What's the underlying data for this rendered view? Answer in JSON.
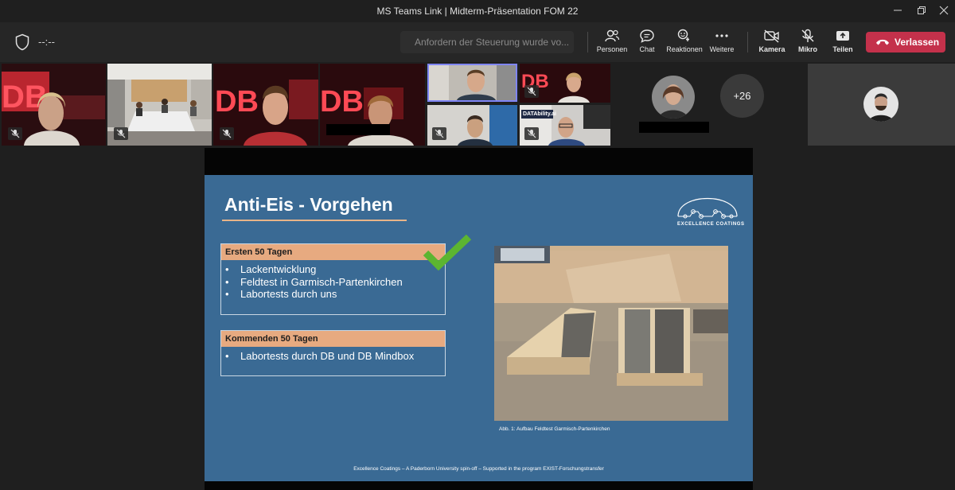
{
  "window": {
    "title": "MS Teams Link | Midterm-Präsentation FOM 22"
  },
  "toolbar": {
    "timer": "--:--",
    "request_control": "Anfordern der Steuerung wurde vo...",
    "buttons": {
      "people": "Personen",
      "chat": "Chat",
      "reactions": "Reaktionen",
      "more": "Weitere",
      "camera": "Kamera",
      "mic": "Mikro",
      "share": "Teilen"
    },
    "leave_label": "Verlassen"
  },
  "participants": {
    "overflow_count": "+26",
    "tile_banner_text": "DATAbility.ai"
  },
  "slide": {
    "title": "Anti-Eis - Vorgehen",
    "logo_text": "EXCELLENCE COATINGS",
    "section1": {
      "header": "Ersten 50 Tagen",
      "items": [
        "Lackentwicklung",
        "Feldtest in Garmisch-Partenkirchen",
        "Labortests durch uns"
      ]
    },
    "section2": {
      "header": "Kommenden 50 Tagen",
      "items": [
        "Labortests durch DB und DB Mindbox"
      ]
    },
    "photo_caption": "Abb. 1: Aufbau Feldtest Garmisch-Partenkirchen",
    "footer": "Excellence Coatings – A Paderborn University spin-off – Supported in the program EXIST-Forschungstransfer"
  },
  "colors": {
    "leave_button": "#c4314b",
    "slide_background": "#3a6a94",
    "section_header": "#e7aa80",
    "checkmark": "#5cb531"
  }
}
